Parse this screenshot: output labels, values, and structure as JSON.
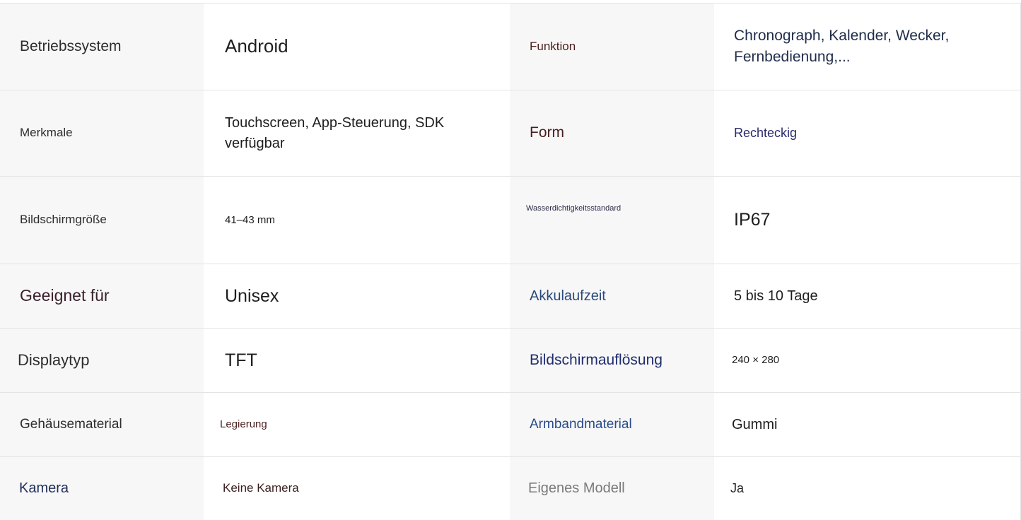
{
  "specs": {
    "rows": [
      {
        "left_label": "Betriebssystem",
        "left_value": "Android",
        "right_label": "Funktion",
        "right_value": "Chronograph, Kalender, Wecker, Fernbedienung,..."
      },
      {
        "left_label": "Merkmale",
        "left_value": "Touchscreen, App-Steuerung, SDK verfügbar",
        "right_label": "Form",
        "right_value": "Rechteckig"
      },
      {
        "left_label": "Bildschirmgröße",
        "left_value": "41–43 mm",
        "right_label": "Wasserdichtigkeitsstandard",
        "right_value": "IP67"
      },
      {
        "left_label": "Geeignet für",
        "left_value": "Unisex",
        "right_label": "Akkulaufzeit",
        "right_value": "5 bis 10 Tage"
      },
      {
        "left_label": "Displaytyp",
        "left_value": "TFT",
        "right_label": "Bildschirmauflösung",
        "right_value": "240 × 280"
      },
      {
        "left_label": "Gehäusematerial",
        "left_value": "Legierung",
        "right_label": "Armbandmaterial",
        "right_value": "Gummi"
      },
      {
        "left_label": "Kamera",
        "left_value": "Keine Kamera",
        "right_label": "Eigenes Modell",
        "right_value": "Ja"
      }
    ]
  }
}
